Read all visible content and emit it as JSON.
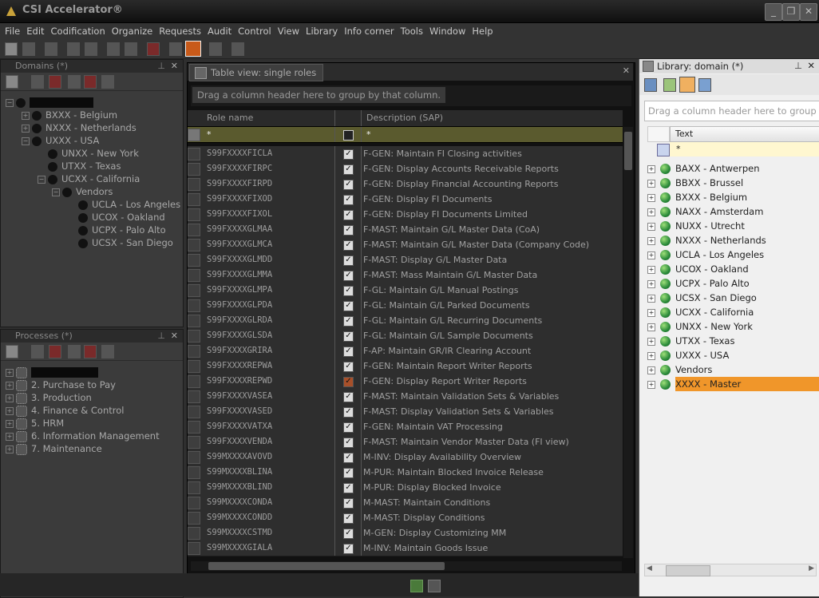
{
  "window": {
    "title": "CSI Accelerator®",
    "minimize": "_",
    "restore": "❐",
    "close": "✕"
  },
  "menu": [
    "File",
    "Edit",
    "Codification",
    "Organize",
    "Requests",
    "Audit",
    "Control",
    "View",
    "Library",
    "Info corner",
    "Tools",
    "Window",
    "Help"
  ],
  "domains_panel": {
    "title": "Domains (*)",
    "tree": [
      {
        "label": "BXXX - Belgium",
        "level": 2
      },
      {
        "label": "NXXX - Netherlands",
        "level": 2
      },
      {
        "label": "UXXX - USA",
        "level": 2
      },
      {
        "label": "UNXX - New York",
        "level": 3
      },
      {
        "label": "UTXX - Texas",
        "level": 3
      },
      {
        "label": "UCXX - California",
        "level": 3
      },
      {
        "label": "Vendors",
        "level": 4
      },
      {
        "label": "UCLA - Los Angeles",
        "level": 5
      },
      {
        "label": "UCOX - Oakland",
        "level": 5
      },
      {
        "label": "UCPX - Palo Alto",
        "level": 5
      },
      {
        "label": "UCSX - San Diego",
        "level": 5
      }
    ]
  },
  "processes_panel": {
    "title": "Processes (*)",
    "items": [
      "2. Purchase to Pay",
      "3. Production",
      "4. Finance & Control",
      "5. HRM",
      "6. Information Management",
      "7. Maintenance"
    ]
  },
  "table_view": {
    "tab_label": "Table view: single roles",
    "group_hint": "Drag a column header here to group by that column.",
    "col_role_name": "Role name",
    "col_description": "Description (SAP)",
    "filter_value": "*",
    "rows": [
      {
        "name": "S99FXXXXFICLA",
        "desc": "F-GEN: Maintain FI Closing activities"
      },
      {
        "name": "S99FXXXXFIRPC",
        "desc": "F-GEN: Display Accounts Receivable Reports"
      },
      {
        "name": "S99FXXXXFIRPD",
        "desc": "F-GEN: Display Financial Accounting Reports"
      },
      {
        "name": "S99FXXXXFIXOD",
        "desc": "F-GEN: Display FI Documents"
      },
      {
        "name": "S99FXXXXFIXOL",
        "desc": "F-GEN: Display FI Documents Limited"
      },
      {
        "name": "S99FXXXXGLMAA",
        "desc": "F-MAST: Maintain G/L Master Data (CoA)"
      },
      {
        "name": "S99FXXXXGLMCA",
        "desc": "F-MAST: Maintain G/L Master Data (Company Code)"
      },
      {
        "name": "S99FXXXXGLMDD",
        "desc": "F-MAST: Display G/L Master Data"
      },
      {
        "name": "S99FXXXXGLMMA",
        "desc": "F-MAST: Mass Maintain G/L Master Data"
      },
      {
        "name": "S99FXXXXGLMPA",
        "desc": "F-GL: Maintain G/L Manual Postings"
      },
      {
        "name": "S99FXXXXGLPDA",
        "desc": "F-GL: Maintain G/L Parked Documents"
      },
      {
        "name": "S99FXXXXGLRDA",
        "desc": "F-GL: Maintain G/L Recurring Documents"
      },
      {
        "name": "S99FXXXXGLSDA",
        "desc": "F-GL: Maintain G/L Sample Documents"
      },
      {
        "name": "S99FXXXXGRIRA",
        "desc": "F-AP: Maintain GR/IR Clearing Account"
      },
      {
        "name": "S99FXXXXREPWA",
        "desc": "F-GEN: Maintain Report Writer Reports"
      },
      {
        "name": "S99FXXXXREPWD",
        "desc": "F-GEN: Display Report Writer Reports"
      },
      {
        "name": "S99FXXXXVASEA",
        "desc": "F-MAST: Maintain Validation Sets & Variables"
      },
      {
        "name": "S99FXXXXVASED",
        "desc": "F-MAST: Display Validation Sets & Variables"
      },
      {
        "name": "S99FXXXXVATXA",
        "desc": "F-GEN: Maintain VAT Processing"
      },
      {
        "name": "S99FXXXXVENDA",
        "desc": "F-MAST: Maintain Vendor Master Data (FI view)"
      },
      {
        "name": "S99MXXXXAVOVD",
        "desc": "M-INV: Display Availability Overview"
      },
      {
        "name": "S99MXXXXBLINA",
        "desc": "M-PUR: Maintain Blocked Invoice Release"
      },
      {
        "name": "S99MXXXXBLIND",
        "desc": "M-PUR: Display Blocked Invoice"
      },
      {
        "name": "S99MXXXXCONDA",
        "desc": "M-MAST: Maintain Conditions"
      },
      {
        "name": "S99MXXXXCONDD",
        "desc": "M-MAST: Display Conditions"
      },
      {
        "name": "S99MXXXXCSTMD",
        "desc": "M-GEN: Display Customizing MM"
      },
      {
        "name": "S99MXXXXGIALA",
        "desc": "M-INV: Maintain Goods Issue"
      }
    ]
  },
  "library": {
    "title": "Library: domain (*)",
    "group_hint": "Drag a column header here to group by",
    "col_text": "Text",
    "filter_value": "*",
    "items": [
      "BAXX - Antwerpen",
      "BBXX - Brussel",
      "BXXX - Belgium",
      "NAXX - Amsterdam",
      "NUXX - Utrecht",
      "NXXX - Netherlands",
      "UCLA - Los Angeles",
      "UCOX - Oakland",
      "UCPX - Palo Alto",
      "UCSX - San Diego",
      "UCXX - California",
      "UNXX - New York",
      "UTXX - Texas",
      "UXXX - USA",
      "Vendors",
      "XXXX - Master"
    ],
    "selected_item": "XXXX - Master"
  },
  "colors": {
    "accent": "#f0962a",
    "filter_row": "#5a5a2e"
  }
}
